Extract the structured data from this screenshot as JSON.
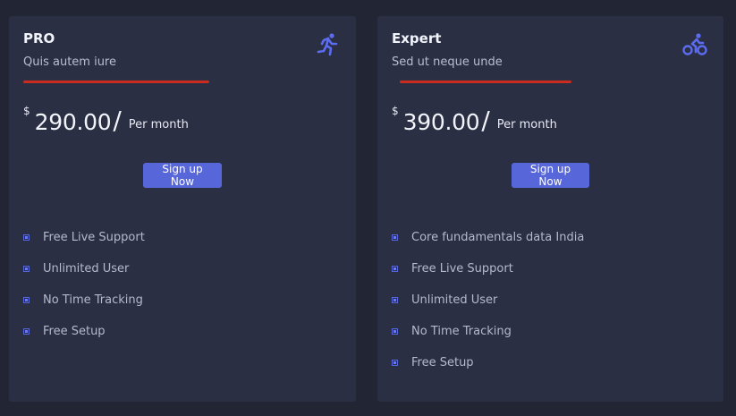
{
  "plans": [
    {
      "name": "PRO",
      "subtitle": "Quis autem iure",
      "currency": "$",
      "amount": "290.00",
      "slash": "/",
      "period": "Per month",
      "cta": "Sign up Now",
      "icon": "running-person-icon",
      "features": [
        "Free Live Support",
        "Unlimited User",
        "No Time Tracking",
        "Free Setup"
      ]
    },
    {
      "name": "Expert",
      "subtitle": "Sed ut neque unde",
      "currency": "$",
      "amount": "390.00",
      "slash": "/",
      "period": "Per month",
      "cta": "Sign up Now",
      "icon": "cyclist-icon",
      "features": [
        "Core fundamentals data India",
        "Free Live Support",
        "Unlimited User",
        "No Time Tracking",
        "Free Setup"
      ]
    }
  ],
  "colors": {
    "background": "#222533",
    "card": "#2b2f43",
    "accent": "#5766d8",
    "underline": "#c92b1e"
  }
}
